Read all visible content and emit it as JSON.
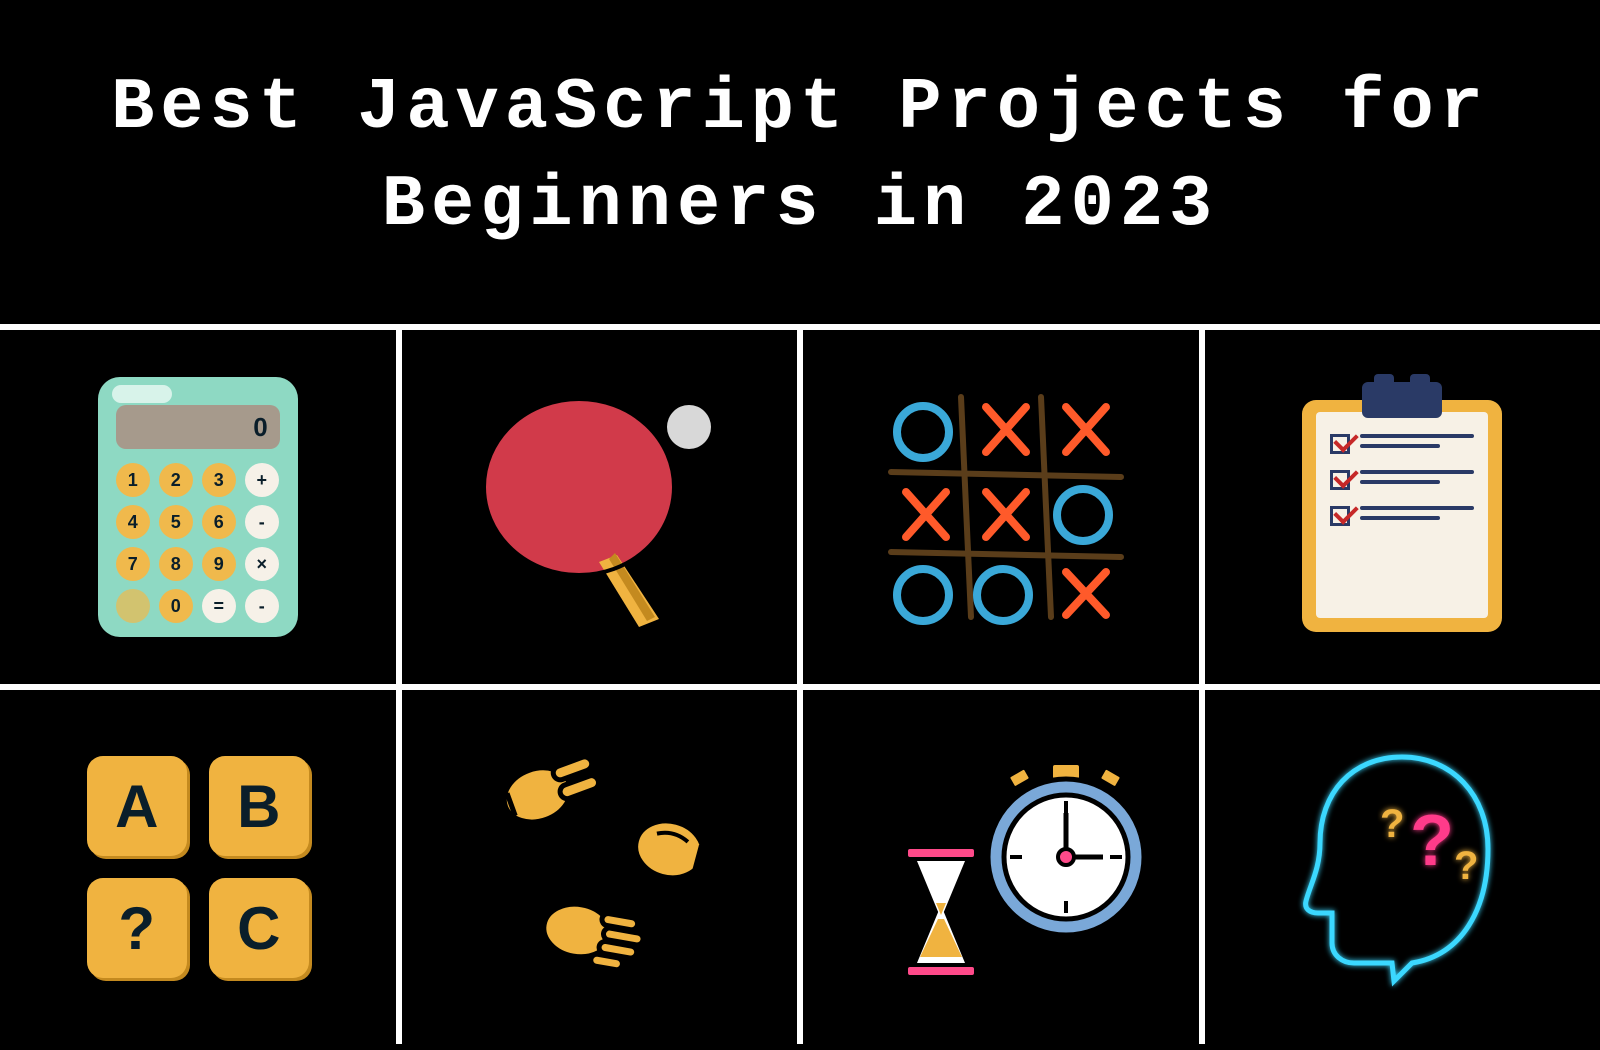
{
  "header": {
    "title": "Best JavaScript Projects for Beginners in 2023"
  },
  "calculator": {
    "screen": "0",
    "keys": [
      "1",
      "2",
      "3",
      "+",
      "4",
      "5",
      "6",
      "-",
      "7",
      "8",
      "9",
      "×",
      "",
      "0",
      "=",
      "-"
    ]
  },
  "abc": {
    "tiles": [
      "A",
      "B",
      "?",
      "C"
    ]
  },
  "projects": [
    {
      "name": "calculator"
    },
    {
      "name": "pong"
    },
    {
      "name": "tic-tac-toe"
    },
    {
      "name": "todo-list"
    },
    {
      "name": "hangman"
    },
    {
      "name": "rock-paper-scissors"
    },
    {
      "name": "stopwatch"
    },
    {
      "name": "quiz"
    }
  ]
}
